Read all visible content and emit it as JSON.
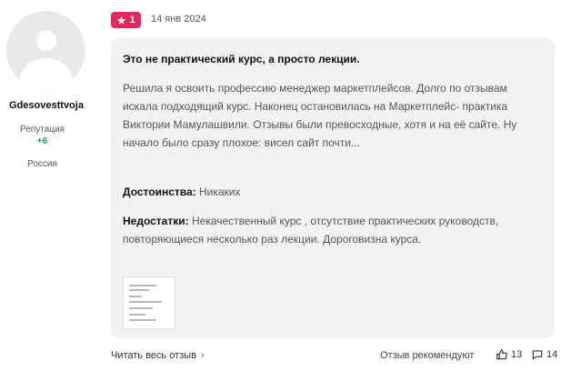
{
  "author": {
    "username": "Gdesovesttvoja",
    "reputation_label": "Репутация",
    "reputation_value": "+6",
    "country": "Россия"
  },
  "review": {
    "rating": "1",
    "date": "14 янв 2024",
    "title": "Это не практический курс, а просто лекции.",
    "text": "Решила я освоить профессию менеджер маркетплейсов. Долго по отзывам искала подходящий курс. Наконец остановилась на Маркетплейс- практика Виктории Мамулашвили. Отзывы были превосходные, хотя и на её сайте. Ну начало было сразу плохое: висел сайт почти...",
    "pros_label": "Достоинства:",
    "pros_text": "Никаких",
    "cons_label": "Недостатки:",
    "cons_text": "Некачественный курс , отсутствие практических руководств, повторяющиеся несколько раз лекции. Дороговизна курса."
  },
  "footer": {
    "read_more": "Читать весь отзыв",
    "recommends": "Отзыв рекомендуют",
    "likes": "13",
    "comments": "14"
  },
  "colors": {
    "accent": "#e8265e",
    "reputation": "#19a53c",
    "card_bg": "#f2f2f4"
  },
  "icons": {
    "star": "star-icon",
    "chevron": "chevron-right-icon",
    "like": "thumbs-up-icon",
    "comment": "comment-icon"
  }
}
